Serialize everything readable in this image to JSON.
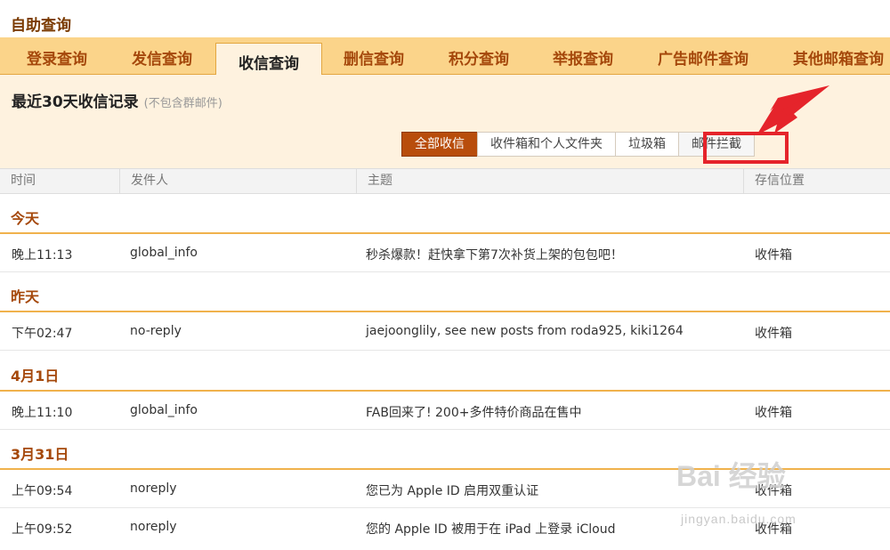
{
  "page": {
    "title": "自助查询"
  },
  "tabs": [
    {
      "label": "登录查询"
    },
    {
      "label": "发信查询"
    },
    {
      "label": "收信查询"
    },
    {
      "label": "删信查询"
    },
    {
      "label": "积分查询"
    },
    {
      "label": "举报查询"
    },
    {
      "label": "广告邮件查询"
    },
    {
      "label": "其他邮箱查询"
    }
  ],
  "panel": {
    "title": "最近30天收信记录",
    "subtitle": "(不包含群邮件)"
  },
  "filters": [
    {
      "label": "全部收信"
    },
    {
      "label": "收件箱和个人文件夹"
    },
    {
      "label": "垃圾箱"
    },
    {
      "label": "邮件拦截"
    }
  ],
  "table": {
    "headers": {
      "time": "时间",
      "sender": "发件人",
      "subject": "主题",
      "location": "存信位置"
    },
    "groups": [
      {
        "label": "今天"
      },
      {
        "label": "昨天"
      },
      {
        "label": "4月1日"
      },
      {
        "label": "3月31日"
      }
    ],
    "rows": [
      {
        "time": "晚上11:13",
        "sender": "global_info",
        "subject": "秒杀爆款！赶快拿下第7次补货上架的包包吧！",
        "location": "收件箱"
      },
      {
        "time": "下午02:47",
        "sender": "no-reply",
        "subject": "jaejoonglily, see new posts from roda925, kiki1264",
        "location": "收件箱"
      },
      {
        "time": "晚上11:10",
        "sender": "global_info",
        "subject": "FAB回来了! 200+多件特价商品在售中",
        "location": "收件箱"
      },
      {
        "time": "上午09:54",
        "sender": "noreply",
        "subject": "您已为 Apple ID 启用双重认证",
        "location": "收件箱"
      },
      {
        "time": "上午09:52",
        "sender": "noreply",
        "subject": "您的 Apple ID 被用于在 iPad 上登录 iCloud",
        "location": "收件箱"
      }
    ]
  },
  "watermark": {
    "text": "Bai 经验",
    "sub": "jingyan.baidu.com"
  },
  "colors": {
    "accent": "#b84d0c",
    "tabbar": "#fbd48a",
    "panel": "#fef2df",
    "highlight": "#e5242b"
  }
}
